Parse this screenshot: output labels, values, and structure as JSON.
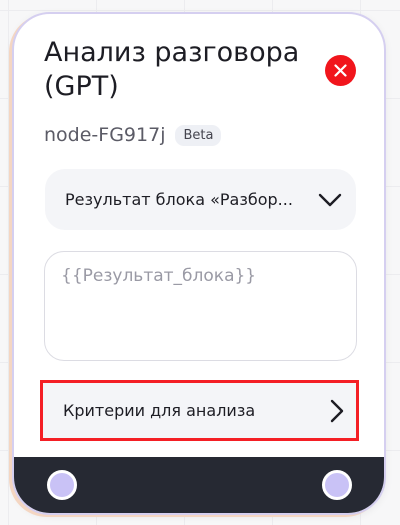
{
  "node": {
    "title": "Анализ разговора (GPT)",
    "id": "node-FG917j",
    "badge": "Beta",
    "close_icon": "close-x-icon",
    "accent_color": "#f1151c"
  },
  "block_select": {
    "value": "Результат блока «Разбор...",
    "icon": "chevron-down-icon"
  },
  "input": {
    "placeholder": "{{Результат_блока}}",
    "value": ""
  },
  "criteria": {
    "label": "Критерии для анализа",
    "icon": "chevron-right-icon"
  },
  "footer": {
    "ports": [
      "input-port",
      "output-port"
    ],
    "port_color": "#c9c2f6",
    "background": "#262933"
  }
}
